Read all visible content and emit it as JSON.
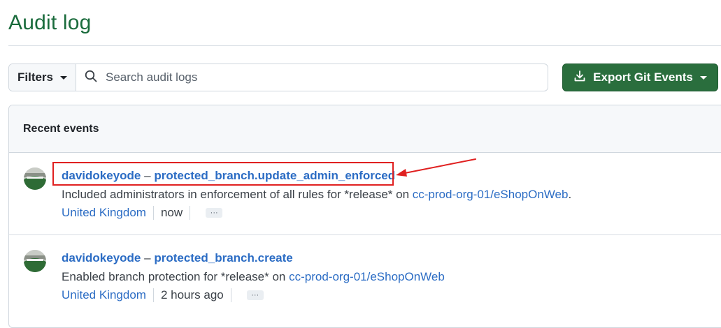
{
  "page": {
    "title": "Audit log"
  },
  "toolbar": {
    "filters_label": "Filters",
    "search_placeholder": "Search audit logs",
    "search_value": "",
    "export_label": "Export Git Events"
  },
  "events": {
    "header": "Recent events",
    "items": [
      {
        "actor": "davidokeyode",
        "separator": "–",
        "action": "protected_branch.update_admin_enforced",
        "description": "Included administrators in enforcement of all rules for *release* on ",
        "repo": "cc-prod-org-01/eShopOnWeb",
        "suffix": ".",
        "location": "United Kingdom",
        "time": "now",
        "more": "···"
      },
      {
        "actor": "davidokeyode",
        "separator": "–",
        "action": "protected_branch.create",
        "description": "Enabled branch protection for *release* on ",
        "repo": "cc-prod-org-01/eShopOnWeb",
        "suffix": "",
        "location": "United Kingdom",
        "time": "2 hours ago",
        "more": "···"
      }
    ]
  },
  "annotation": {
    "color": "#e02020"
  },
  "colors": {
    "accent": "#1a6b3c",
    "button": "#2a6e3d",
    "link": "#2b6cc4"
  }
}
